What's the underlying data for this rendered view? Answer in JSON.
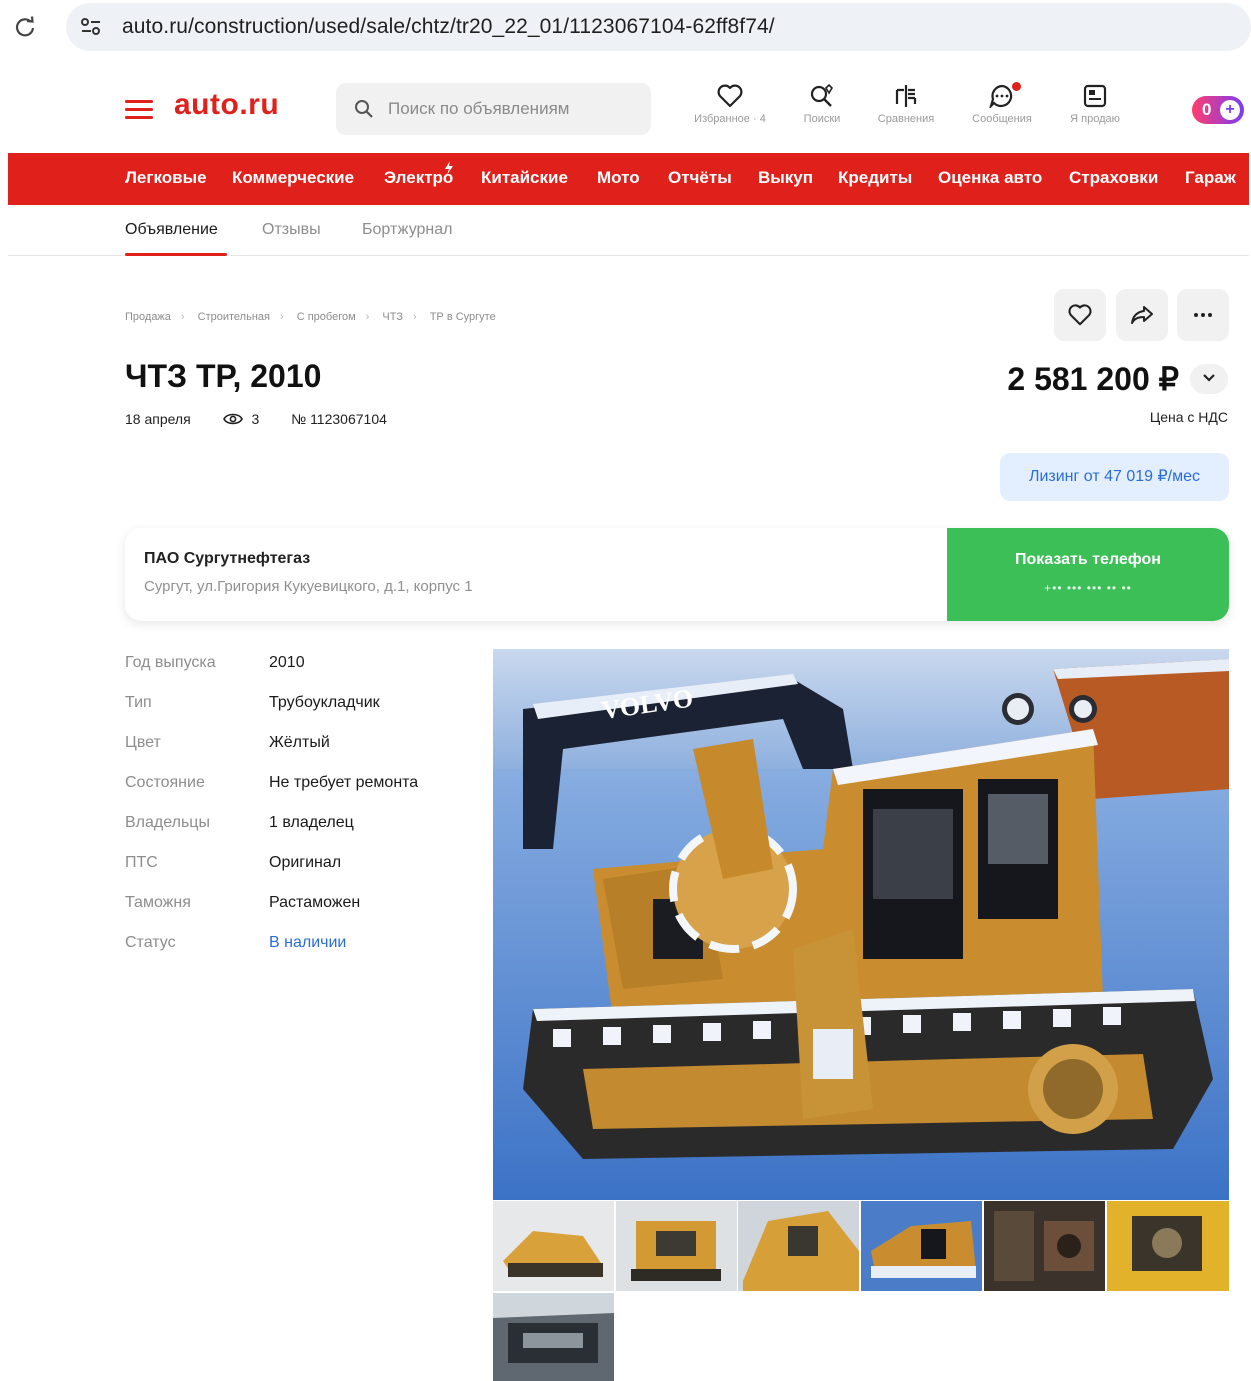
{
  "browser": {
    "url": "auto.ru/construction/used/sale/chtz/tr20_22_01/1123067104-62ff8f74/"
  },
  "header": {
    "logo": "auto.ru",
    "search_placeholder": "Поиск по объявлениям",
    "icons": [
      {
        "label": "Избранное · 4",
        "icon": "heart-icon"
      },
      {
        "label": "Поиски",
        "icon": "saved-search-icon"
      },
      {
        "label": "Сравнения",
        "icon": "compare-icon"
      },
      {
        "label": "Сообщения",
        "icon": "chat-icon"
      },
      {
        "label": "Я продаю",
        "icon": "sell-icon"
      }
    ],
    "profile_badge": "0"
  },
  "nav": {
    "items": [
      "Легковые",
      "Коммерческие",
      "Электро",
      "Китайские",
      "Мото",
      "Отчёты",
      "Выкуп",
      "Кредиты",
      "Оценка авто",
      "Страховки",
      "Гараж"
    ]
  },
  "tabs": {
    "items": [
      "Объявление",
      "Отзывы",
      "Бортжурнал"
    ],
    "active": "Объявление"
  },
  "breadcrumb": [
    "Продажа",
    "Строительная",
    "С пробегом",
    "ЧТЗ",
    "ТР в Сургуте"
  ],
  "listing": {
    "title": "ЧТЗ ТР, 2010",
    "date": "18 апреля",
    "views": "3",
    "number": "№ 1123067104",
    "price": "2 581 200 ₽",
    "vat_note": "Цена с НДС",
    "leasing": "Лизинг от 47 019 ₽/мес"
  },
  "seller": {
    "name": "ПАО Сургутнефтегаз",
    "address": "Сургут, ул.Григория Кукуевицкого, д.1, корпус 1",
    "phone_button": "Показать телефон",
    "phone_masked": "+•• ••• ••• •• ••"
  },
  "specs": [
    {
      "key": "Год выпуска",
      "value": "2010"
    },
    {
      "key": "Тип",
      "value": "Трубоукладчик"
    },
    {
      "key": "Цвет",
      "value": "Жёлтый"
    },
    {
      "key": "Состояние",
      "value": "Не требует ремонта"
    },
    {
      "key": "Владельцы",
      "value": "1 владелец"
    },
    {
      "key": "ПТС",
      "value": "Оригинал"
    },
    {
      "key": "Таможня",
      "value": "Растаможен"
    },
    {
      "key": "Статус",
      "value": "В наличии"
    }
  ],
  "gallery": {
    "main_photo_text": "VOLVO",
    "thumbnail_count": 7
  },
  "colors": {
    "brand_red": "#e0201b",
    "phone_green": "#3cbf57",
    "link_blue": "#2b6dd8",
    "machine_yellow": "#d9a13a"
  }
}
